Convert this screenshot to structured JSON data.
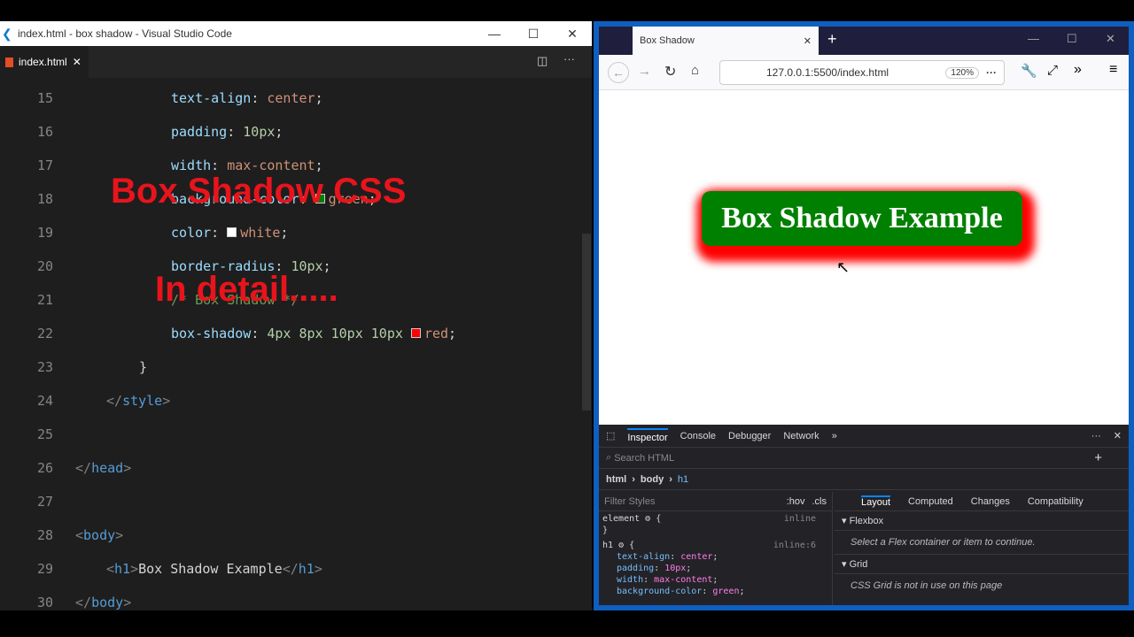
{
  "vscode": {
    "title": "index.html - box shadow - Visual Studio Code",
    "tab": "index.html",
    "close": "✕",
    "min": "—",
    "max": "☐",
    "x": "✕",
    "lines": [
      {
        "n": "15",
        "indent": 193,
        "parts": [
          [
            "prop",
            "text-align"
          ],
          [
            "pn",
            ": "
          ],
          [
            "val",
            "center"
          ],
          [
            "pn",
            ";"
          ]
        ]
      },
      {
        "n": "16",
        "indent": 193,
        "parts": [
          [
            "prop",
            "padding"
          ],
          [
            "pn",
            ": "
          ],
          [
            "num",
            "10px"
          ],
          [
            "pn",
            ";"
          ]
        ]
      },
      {
        "n": "17",
        "indent": 193,
        "parts": [
          [
            "prop",
            "width"
          ],
          [
            "pn",
            ": "
          ],
          [
            "val",
            "max-content"
          ],
          [
            "pn",
            ";"
          ]
        ]
      },
      {
        "n": "18",
        "indent": 193,
        "parts": [
          [
            "prop",
            "background-color"
          ],
          [
            "pn",
            ": "
          ],
          [
            "sw",
            "#008000"
          ],
          [
            "val",
            "green"
          ],
          [
            "pn",
            ";"
          ]
        ]
      },
      {
        "n": "19",
        "indent": 193,
        "parts": [
          [
            "prop",
            "color"
          ],
          [
            "pn",
            ": "
          ],
          [
            "sw",
            "#ffffff"
          ],
          [
            "val",
            "white"
          ],
          [
            "pn",
            ";"
          ]
        ]
      },
      {
        "n": "20",
        "indent": 193,
        "parts": [
          [
            "prop",
            "border-radius"
          ],
          [
            "pn",
            ": "
          ],
          [
            "num",
            "10px"
          ],
          [
            "pn",
            ";"
          ]
        ]
      },
      {
        "n": "21",
        "indent": 193,
        "parts": [
          [
            "cm",
            "/* Box Shadow */"
          ]
        ]
      },
      {
        "n": "22",
        "indent": 193,
        "parts": [
          [
            "prop",
            "box-shadow"
          ],
          [
            "pn",
            ": "
          ],
          [
            "num",
            "4px 8px 10px 10px "
          ],
          [
            "sw",
            "#ff0000"
          ],
          [
            "val",
            "red"
          ],
          [
            "pn",
            ";"
          ]
        ]
      },
      {
        "n": "23",
        "indent": 157,
        "parts": [
          [
            "pn",
            "}"
          ]
        ]
      },
      {
        "n": "24",
        "indent": 120,
        "parts": [
          [
            "br",
            "</"
          ],
          [
            "tag",
            "style"
          ],
          [
            "br",
            ">"
          ]
        ]
      },
      {
        "n": "25",
        "indent": 85,
        "parts": []
      },
      {
        "n": "26",
        "indent": 85,
        "parts": [
          [
            "br",
            "</"
          ],
          [
            "tag",
            "head"
          ],
          [
            "br",
            ">"
          ]
        ]
      },
      {
        "n": "27",
        "indent": 85,
        "parts": []
      },
      {
        "n": "28",
        "indent": 85,
        "parts": [
          [
            "br",
            "<"
          ],
          [
            "tag",
            "body"
          ],
          [
            "br",
            ">"
          ]
        ]
      },
      {
        "n": "29",
        "indent": 120,
        "parts": [
          [
            "br",
            "<"
          ],
          [
            "tag",
            "h1"
          ],
          [
            "br",
            ">"
          ],
          [
            "pn",
            "Box Shadow Example"
          ],
          [
            "br",
            "</"
          ],
          [
            "tag",
            "h1"
          ],
          [
            "br",
            ">"
          ]
        ]
      },
      {
        "n": "30",
        "indent": 85,
        "parts": [
          [
            "br",
            "</"
          ],
          [
            "tag",
            "body"
          ],
          [
            "br",
            ">"
          ]
        ]
      }
    ]
  },
  "overlay": {
    "line1": "Box Shadow CSS",
    "line2": "In detail....."
  },
  "browser": {
    "tab": "Box Shadow",
    "url": "127.0.0.1:5500/index.html",
    "zoom": "120%",
    "heading": "Box Shadow Example",
    "devtools": {
      "tabs": [
        "Inspector",
        "Console",
        "Debugger",
        "Network"
      ],
      "search": "Search HTML",
      "crumbs": [
        "html",
        "body",
        "h1"
      ],
      "filter": "Filter Styles",
      "hov": ":hov",
      "cls": ".cls",
      "sidetabs": [
        "Layout",
        "Computed",
        "Changes",
        "Compatibility"
      ],
      "flexbox": "Flexbox",
      "flex_msg": "Select a Flex container or item to continue.",
      "grid": "Grid",
      "grid_msg": "CSS Grid is not in use on this page",
      "rules": [
        {
          "sel": "element",
          "src": "inline"
        },
        {
          "sel": "h1",
          "src": "inline:6"
        }
      ],
      "decls": [
        [
          "text-align",
          "center"
        ],
        [
          "padding",
          "10px"
        ],
        [
          "width",
          "max-content"
        ],
        [
          "background-color",
          "green"
        ]
      ]
    }
  }
}
